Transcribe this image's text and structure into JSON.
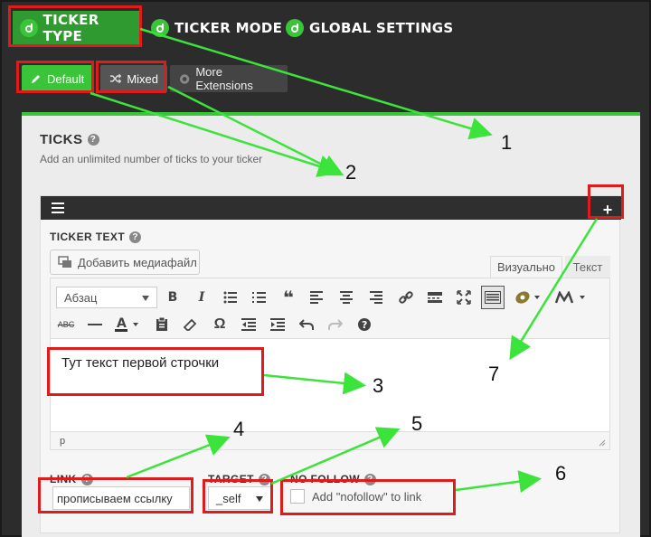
{
  "top_tabs": [
    {
      "label": "TICKER TYPE",
      "icon": "ditty-logo-icon",
      "active": true
    },
    {
      "label": "TICKER MODE",
      "icon": "ditty-logo-icon"
    },
    {
      "label": "GLOBAL SETTINGS",
      "icon": "ditty-logo-icon"
    }
  ],
  "sub_tabs": [
    {
      "label": "Default",
      "icon": "pencil-icon",
      "active": true
    },
    {
      "label": "Mixed",
      "icon": "shuffle-icon"
    },
    {
      "label": "More Extensions",
      "icon": "plus-circle-icon"
    }
  ],
  "ticks": {
    "title": "TICKS",
    "description": "Add an unlimited number of ticks to your ticker"
  },
  "tick_editor": {
    "ticker_text_label": "TICKER TEXT",
    "media_button": "Добавить медиафайл",
    "mode_visual": "Визуально",
    "mode_text": "Текст",
    "format_select": "Абзац",
    "content": "Тут текст первой строчки",
    "status_path": "p"
  },
  "link": {
    "label": "LINK",
    "value": "прописываем ссылку"
  },
  "target": {
    "label": "TARGET",
    "value": "_self"
  },
  "nofollow": {
    "label": "NO FOLLOW",
    "checkbox_label": "Add \"nofollow\" to link"
  },
  "annotations": {
    "n1": "1",
    "n2": "2",
    "n3": "3",
    "n4": "4",
    "n5": "5",
    "n6": "6",
    "n7": "7"
  },
  "colors": {
    "accent_green": "#3ac43a",
    "annotation_red": "#e01b1b",
    "arrow_green": "#3be33b",
    "dark_bg": "#2c2c2c"
  }
}
